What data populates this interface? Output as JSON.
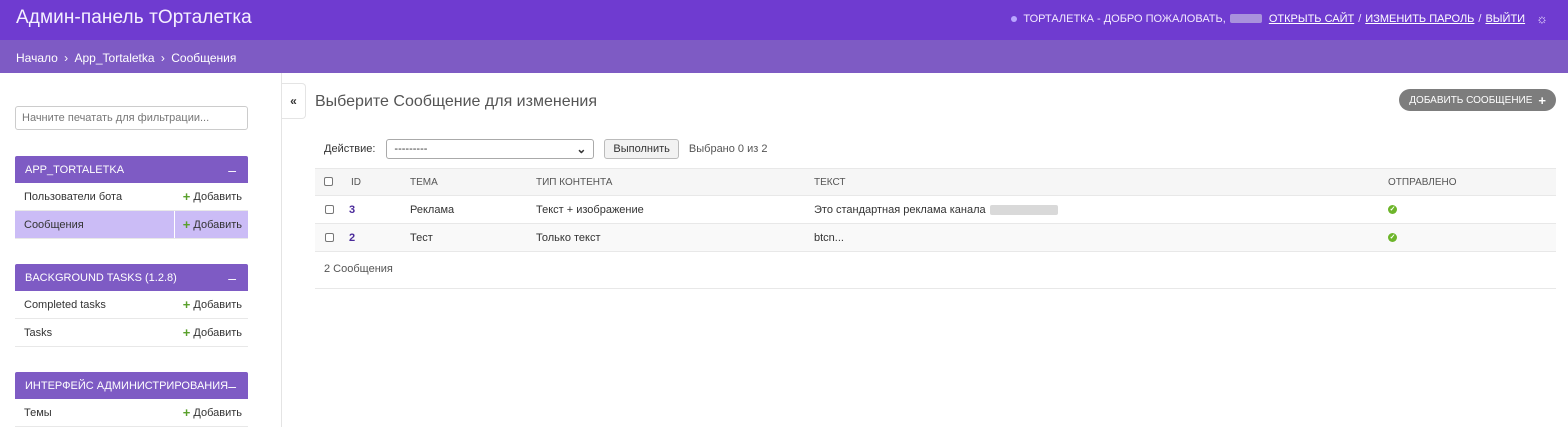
{
  "header": {
    "title": "Админ-панель тОрталетка",
    "welcome": "ТОРТАЛЕТКА - ДОБРО ПОЖАЛОВАТЬ,",
    "view_site": "ОТКРЫТЬ САЙТ",
    "change_password": "ИЗМЕНИТЬ ПАРОЛЬ",
    "logout": "ВЫЙТИ",
    "separator": "/"
  },
  "breadcrumbs": {
    "home": "Начало",
    "app": "App_Tortaletka",
    "current": "Сообщения",
    "separator": "›"
  },
  "sidebar": {
    "filter_placeholder": "Начните печатать для фильтрации...",
    "collapse_symbol": "–",
    "toggle_symbol": "«",
    "add_label": "Добавить",
    "modules": [
      {
        "title": "APP_TORTALETKA",
        "items": [
          {
            "label": "Пользователи бота",
            "active": false
          },
          {
            "label": "Сообщения",
            "active": true
          }
        ]
      },
      {
        "title": "BACKGROUND TASKS (1.2.8)",
        "items": [
          {
            "label": "Completed tasks",
            "active": false
          },
          {
            "label": "Tasks",
            "active": false
          }
        ]
      },
      {
        "title": "ИНТЕРФЕЙС АДМИНИСТРИРОВАНИЯ",
        "items": [
          {
            "label": "Темы",
            "active": false
          }
        ]
      }
    ]
  },
  "content": {
    "title": "Выберите Сообщение для изменения",
    "add_button": "ДОБАВИТЬ СООБЩЕНИЕ",
    "actions": {
      "label": "Действие:",
      "selected_value": "---------",
      "run_label": "Выполнить",
      "counter": "Выбрано 0 из 2"
    },
    "table": {
      "columns": [
        "ID",
        "ТЕМА",
        "ТИП КОНТЕНТА",
        "ТЕКСТ",
        "ОТПРАВЛЕНО"
      ],
      "rows": [
        {
          "id": "3",
          "subject": "Реклама",
          "content_type": "Текст + изображение",
          "text": "Это стандартная реклама канала",
          "sent": true
        },
        {
          "id": "2",
          "subject": "Тест",
          "content_type": "Только текст",
          "text": "btcn...",
          "sent": true
        }
      ]
    },
    "paginator": "2 Сообщения"
  },
  "colors": {
    "header": "#6f3bd0",
    "breadcrumbs": "#7e5bc4",
    "module_header": "#7e5bc4",
    "active_row": "#cbbcf6",
    "add_plus": "#5aa02c",
    "sent_icon": "#6db52a"
  },
  "icons": {
    "theme_toggle": "sun-icon",
    "sent": "check-circle-icon",
    "add": "plus-icon"
  }
}
